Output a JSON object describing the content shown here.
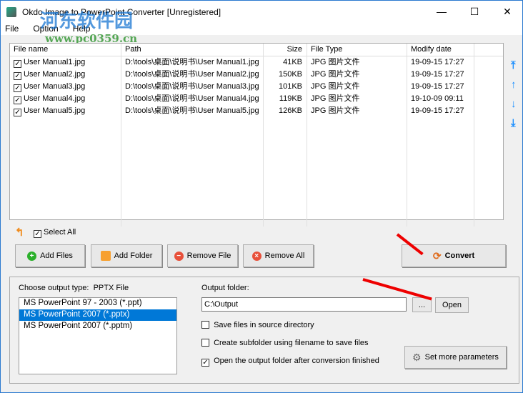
{
  "window": {
    "title": "Okdo Image to PowerPoint Converter [Unregistered]",
    "minimize": "—",
    "maximize": "☐",
    "close": "✕"
  },
  "menu": [
    "File",
    "Option",
    "Help"
  ],
  "watermark": {
    "cn": "河东软件园",
    "url": "www.pc0359.cn"
  },
  "table": {
    "headers": [
      "File name",
      "Path",
      "Size",
      "File Type",
      "Modify date"
    ],
    "rows": [
      {
        "name": "User Manual1.jpg",
        "path": "D:\\tools\\桌面\\说明书\\User Manual1.jpg",
        "size": "41KB",
        "type": "JPG 图片文件",
        "date": "19-09-15 17:27"
      },
      {
        "name": "User Manual2.jpg",
        "path": "D:\\tools\\桌面\\说明书\\User Manual2.jpg",
        "size": "150KB",
        "type": "JPG 图片文件",
        "date": "19-09-15 17:27"
      },
      {
        "name": "User Manual3.jpg",
        "path": "D:\\tools\\桌面\\说明书\\User Manual3.jpg",
        "size": "101KB",
        "type": "JPG 图片文件",
        "date": "19-09-15 17:27"
      },
      {
        "name": "User Manual4.jpg",
        "path": "D:\\tools\\桌面\\说明书\\User Manual4.jpg",
        "size": "119KB",
        "type": "JPG 图片文件",
        "date": "19-10-09 09:11"
      },
      {
        "name": "User Manual5.jpg",
        "path": "D:\\tools\\桌面\\说明书\\User Manual5.jpg",
        "size": "126KB",
        "type": "JPG 图片文件",
        "date": "19-09-15 17:27"
      }
    ]
  },
  "select_all": "Select All",
  "buttons": {
    "add_files": "Add Files",
    "add_folder": "Add Folder",
    "remove_file": "Remove File",
    "remove_all": "Remove All",
    "convert": "Convert",
    "browse": "...",
    "open": "Open",
    "set_params": "Set more parameters"
  },
  "output": {
    "type_label": "Choose output type:",
    "type_value": "PPTX File",
    "types": [
      "MS PowerPoint 97 - 2003 (*.ppt)",
      "MS PowerPoint 2007 (*.pptx)",
      "MS PowerPoint 2007 (*.pptm)"
    ],
    "selected": 1,
    "folder_label": "Output folder:",
    "folder": "C:\\Output",
    "options": [
      {
        "label": "Save files in source directory",
        "checked": false
      },
      {
        "label": "Create subfolder using filename to save files",
        "checked": false
      },
      {
        "label": "Open the output folder after conversion finished",
        "checked": true
      }
    ]
  }
}
